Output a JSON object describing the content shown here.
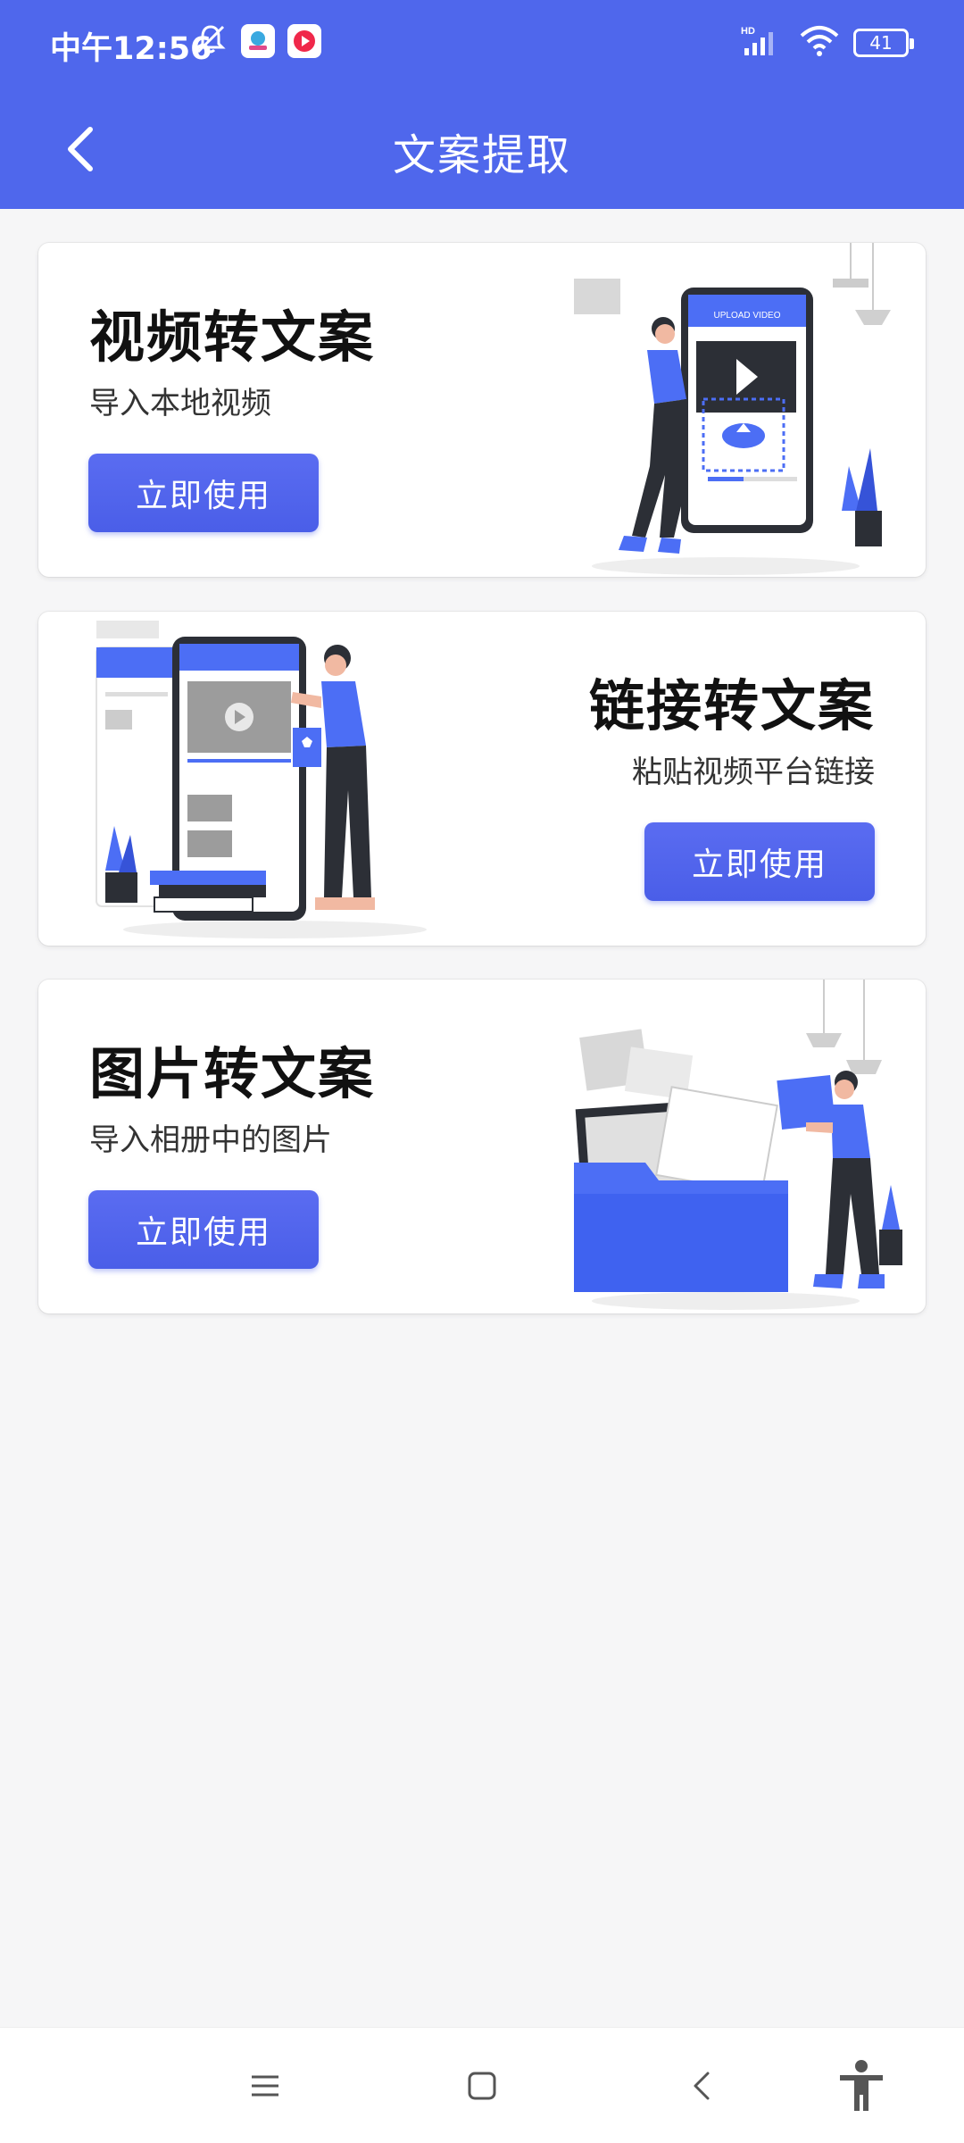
{
  "status_bar": {
    "time": "中午12:56",
    "battery": "41",
    "network_label": "HD"
  },
  "header": {
    "title": "文案提取"
  },
  "cards": [
    {
      "title": "视频转文案",
      "subtitle": "导入本地视频",
      "button": "立即使用",
      "illustration_text": "UPLOAD VIDEO"
    },
    {
      "title": "链接转文案",
      "subtitle": "粘贴视频平台链接",
      "button": "立即使用"
    },
    {
      "title": "图片转文案",
      "subtitle": "导入相册中的图片",
      "button": "立即使用"
    }
  ],
  "nav": {
    "menu_icon": "menu-icon",
    "home_icon": "home-icon",
    "back_icon": "back-icon",
    "accessibility_icon": "accessibility-icon"
  },
  "colors": {
    "primary": "#4f67ec",
    "button": "#4a5ee8",
    "background": "#f6f6f7"
  }
}
